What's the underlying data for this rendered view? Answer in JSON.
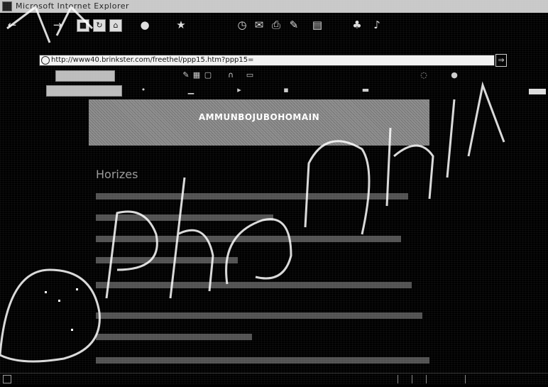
{
  "window": {
    "title": "Microsoft Internet Explorer"
  },
  "toolbar": {
    "buttons": [
      {
        "name": "back",
        "glyph": "←"
      },
      {
        "name": "forward",
        "glyph": "→"
      },
      {
        "name": "stop",
        "glyph": "■"
      },
      {
        "name": "refresh",
        "glyph": "↻"
      },
      {
        "name": "home",
        "glyph": "⌂"
      },
      {
        "name": "search",
        "glyph": "●"
      },
      {
        "name": "favorites",
        "glyph": "★"
      },
      {
        "name": "history",
        "glyph": "◷"
      },
      {
        "name": "mail",
        "glyph": "✉"
      },
      {
        "name": "print",
        "glyph": "⎙"
      },
      {
        "name": "edit",
        "glyph": "✎"
      },
      {
        "name": "discuss",
        "glyph": "▤"
      },
      {
        "name": "messenger",
        "glyph": "♣"
      },
      {
        "name": "media",
        "glyph": "♪"
      }
    ]
  },
  "address": {
    "url": "http://www40.brinkster.com/freethel/ppp15.htm?ppp15=",
    "go_glyph": "⇒"
  },
  "banner": {
    "text": "AMMUNBOJUBOHOMAIN"
  },
  "content": {
    "heading": "Horizes"
  }
}
